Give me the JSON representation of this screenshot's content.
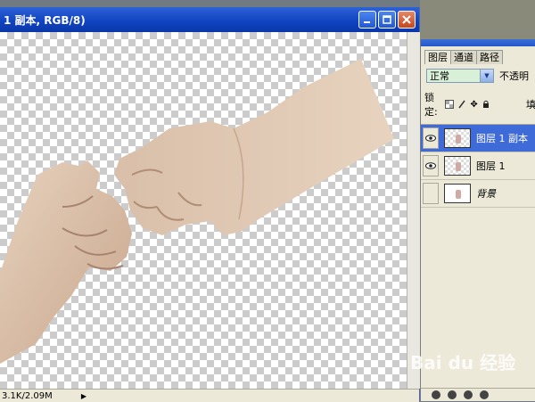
{
  "document": {
    "title": "1 副本, RGB/8)",
    "status": "3.1K/2.09M"
  },
  "layers_panel": {
    "tabs": [
      {
        "label": "图层"
      },
      {
        "label": "通道"
      },
      {
        "label": "路径"
      }
    ],
    "blend_mode": "正常",
    "opacity_label": "不透明",
    "lock_label": "锁定:",
    "fill_label": "填",
    "layers": [
      {
        "name": "图层 1 副本",
        "visible": true,
        "selected": true
      },
      {
        "name": "图层 1",
        "visible": true,
        "selected": false
      },
      {
        "name": "背景",
        "visible": false,
        "selected": false
      }
    ]
  },
  "watermark": "Bai du 经验",
  "colors": {
    "title_bar": "#1144c2",
    "selected_layer": "#3f6bd9",
    "panel_bg": "#ece9d8"
  }
}
